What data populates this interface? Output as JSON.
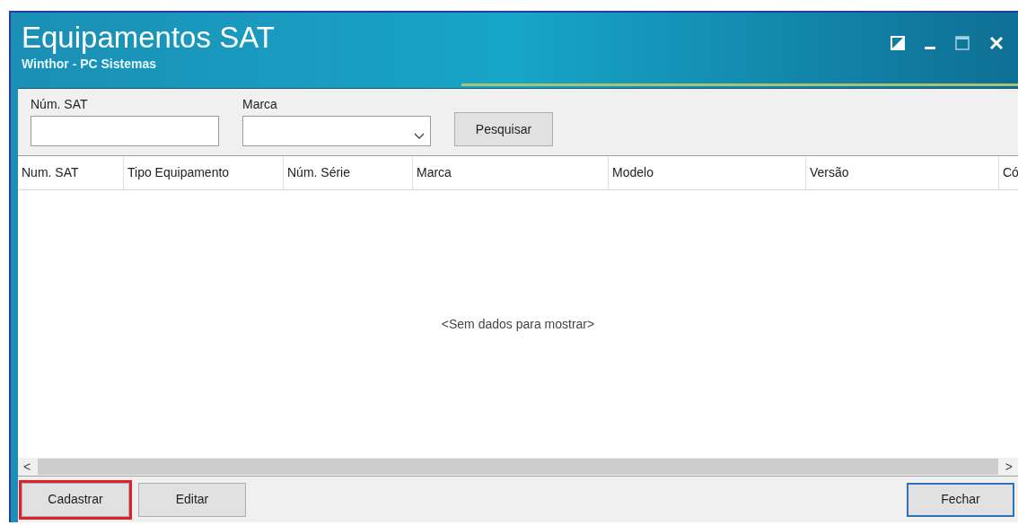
{
  "window": {
    "title": "Equipamentos SAT",
    "subtitle": "Winthor - PC Sistemas"
  },
  "filters": [
    {
      "kind": "text",
      "label": "Núm. SAT"
    },
    {
      "kind": "dropdown",
      "label": "Marca"
    }
  ],
  "search_button": "Pesquisar",
  "table": {
    "columns": [
      "Num. SAT",
      "Tipo Equipamento",
      "Núm. Série",
      "Marca",
      "Modelo",
      "Versão",
      "Có"
    ],
    "empty_message": "<Sem dados para mostrar>"
  },
  "scroll_arrows": [
    "<",
    ">"
  ],
  "buttons": [
    {
      "label": "Cadastrar",
      "highlighted": true,
      "focused": false
    },
    {
      "label": "Editar",
      "highlighted": false,
      "focused": false
    },
    {
      "label": "Fechar",
      "highlighted": false,
      "focused": true
    }
  ]
}
